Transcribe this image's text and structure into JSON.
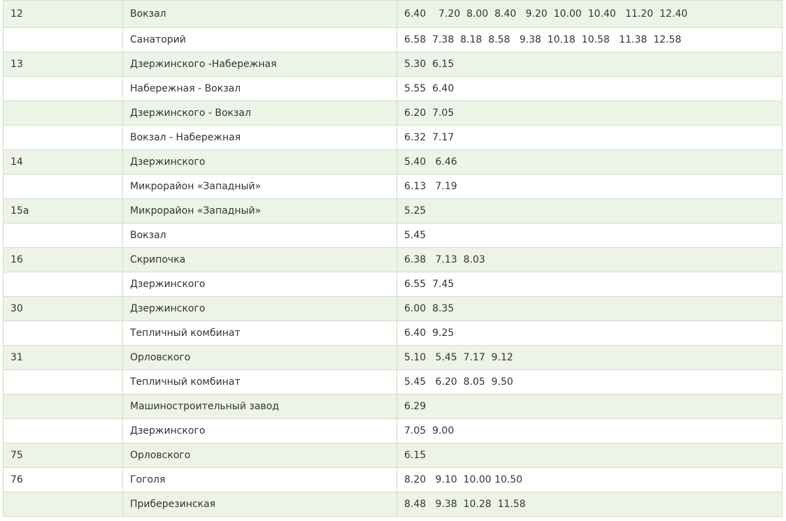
{
  "schedule": {
    "rows": [
      {
        "route": "12",
        "stop": "Вокзал",
        "times": "6.40    7.20  8.00  8.40   9.20  10.00  10.40   11.20  12.40"
      },
      {
        "route": "",
        "stop": "Санаторий",
        "times": "6.58  7.38  8.18  8.58   9.38  10.18  10.58   11.38  12.58"
      },
      {
        "route": "13",
        "stop": "Дзержинского -Набережная",
        "times": "5.30  6.15"
      },
      {
        "route": "",
        "stop": "Набережная - Вокзал",
        "times": "5.55  6.40"
      },
      {
        "route": "",
        "stop": "Дзержинского - Вокзал",
        "times": "6.20  7.05"
      },
      {
        "route": "",
        "stop": "Вокзал - Набережная",
        "times": "6.32  7.17"
      },
      {
        "route": "14",
        "stop": "Дзержинского",
        "times": "5.40   6.46"
      },
      {
        "route": "",
        "stop": "Микрорайон «Западный»",
        "times": "6.13   7.19"
      },
      {
        "route": "15а",
        "stop": "Микрорайон «Западный»",
        "times": "5.25"
      },
      {
        "route": "",
        "stop": "Вокзал",
        "times": "5.45"
      },
      {
        "route": "16",
        "stop": "Скрипочка",
        "times": "6.38   7.13  8.03"
      },
      {
        "route": "",
        "stop": "Дзержинского",
        "times": "6.55  7.45"
      },
      {
        "route": "30",
        "stop": "Дзержинского",
        "times": "6.00  8.35"
      },
      {
        "route": "",
        "stop": "Тепличный комбинат",
        "times": "6.40  9.25"
      },
      {
        "route": "31",
        "stop": "Орловского",
        "times": "5.10   5.45  7.17  9.12"
      },
      {
        "route": "",
        "stop": "Тепличный комбинат",
        "times": "5.45   6.20  8.05  9.50"
      },
      {
        "route": "",
        "stop": "Машиностроительный завод",
        "times": "6.29"
      },
      {
        "route": "",
        "stop": "Дзержинского",
        "times": "7.05  9.00"
      },
      {
        "route": "75",
        "stop": "Орловского",
        "times": "6.15"
      },
      {
        "route": "76",
        "stop": "Гоголя",
        "times": "8.20   9.10  10.00 10.50"
      },
      {
        "route": "",
        "stop": "Приберезинская",
        "times": "8.48   9.38  10.28  11.58"
      }
    ]
  },
  "colors": {
    "border": "#cfe0c0",
    "row_alt": "#eef3e8",
    "text": "#333333"
  }
}
